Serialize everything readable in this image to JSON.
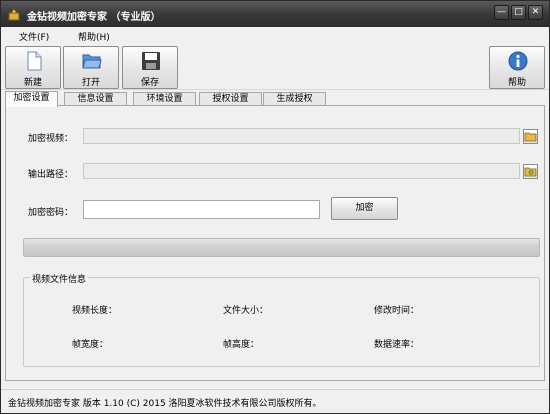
{
  "window": {
    "title": "金钻视频加密专家 （专业版）",
    "controls": {
      "minimize": "—",
      "maximize": "□",
      "close": "✕"
    }
  },
  "menu": [
    {
      "label": "文件(F)",
      "icon": ""
    },
    {
      "label": "帮助(H)",
      "icon": ""
    }
  ],
  "toolbar": {
    "buttons": [
      {
        "label": "新建",
        "icon": "new-file-icon"
      },
      {
        "label": "打开",
        "icon": "folder-open-icon"
      },
      {
        "label": "保存",
        "icon": "floppy-disk-icon"
      },
      {
        "label": "帮助",
        "icon": "info-icon"
      }
    ]
  },
  "tabs": [
    "加密设置",
    "信息设置",
    "环境设置",
    "授权设置",
    "生成授权"
  ],
  "encrypt": {
    "video_label": "加密视频：",
    "video_value": "",
    "output_label": "输出路径：",
    "output_value": "",
    "password_label": "加密密码：",
    "password_value": "",
    "encrypt_button": "加密",
    "progress": 0
  },
  "file_info": {
    "title": "视频文件信息",
    "fields": [
      {
        "label": "视频长度：",
        "value": ""
      },
      {
        "label": "文件大小：",
        "value": ""
      },
      {
        "label": "修改时间：",
        "value": ""
      },
      {
        "label": "帧宽度：",
        "value": ""
      },
      {
        "label": "帧高度：",
        "value": ""
      },
      {
        "label": "数据速率：",
        "value": ""
      }
    ]
  },
  "status": "金钻视频加密专家  版本 1.10 (C)  2015 洛阳夏冰软件技术有限公司版权所有。",
  "colors": {
    "titlebar": "#3a3a3a",
    "progress_fill": "#4fbf3a",
    "accent_blue": "#3a78c9",
    "folder_yellow": "#e7b84a"
  }
}
